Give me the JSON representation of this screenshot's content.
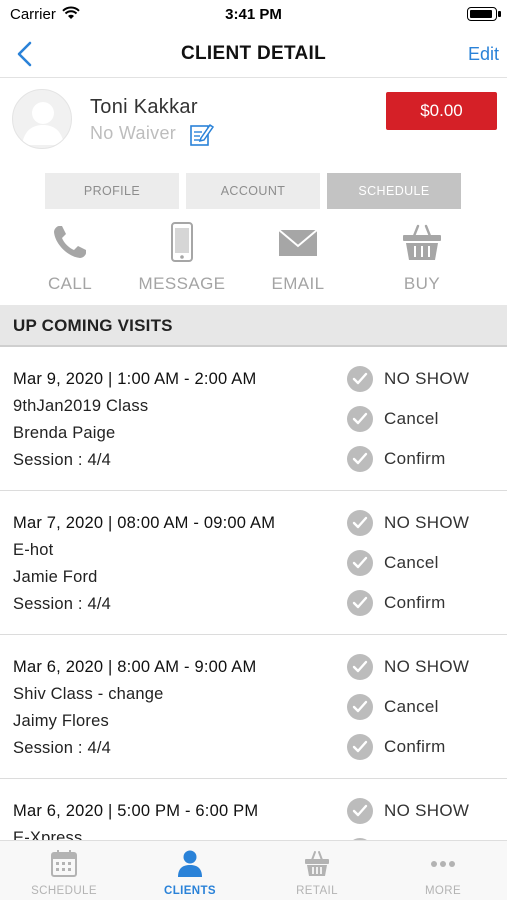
{
  "status_bar": {
    "carrier": "Carrier",
    "time": "3:41 PM"
  },
  "nav": {
    "title": "CLIENT DETAIL",
    "edit": "Edit"
  },
  "client": {
    "name": "Toni Kakkar",
    "waiver": "No Waiver",
    "balance": "$0.00"
  },
  "tabs": [
    {
      "label": "PROFILE",
      "active": false
    },
    {
      "label": "ACCOUNT",
      "active": false
    },
    {
      "label": "SCHEDULE",
      "active": true
    }
  ],
  "actions": [
    {
      "label": "CALL",
      "icon": "phone-icon"
    },
    {
      "label": "MESSAGE",
      "icon": "mobile-phone-icon"
    },
    {
      "label": "EMAIL",
      "icon": "envelope-icon"
    },
    {
      "label": "BUY",
      "icon": "basket-icon"
    }
  ],
  "section_title": "UP COMING VISITS",
  "status_labels": [
    "NO SHOW",
    "Cancel",
    "Confirm"
  ],
  "visits": [
    {
      "datetime": "Mar 9, 2020 | 1:00 AM - 2:00 AM",
      "class": "9thJan2019 Class",
      "staff": "Brenda Paige",
      "session": "Session : 4/4"
    },
    {
      "datetime": "Mar 7, 2020 | 08:00 AM - 09:00 AM",
      "class": "E-hot",
      "staff": "Jamie Ford",
      "session": "Session : 4/4"
    },
    {
      "datetime": "Mar 6, 2020 | 8:00 AM - 9:00 AM",
      "class": "Shiv Class - change",
      "staff": "Jaimy Flores",
      "session": "Session : 4/4"
    },
    {
      "datetime": "Mar 6, 2020 | 5:00 PM - 6:00 PM",
      "class": "E-Xpress",
      "staff": "",
      "session": ""
    }
  ],
  "tabbar": [
    {
      "label": "SCHEDULE",
      "icon": "calendar-icon",
      "active": false
    },
    {
      "label": "CLIENTS",
      "icon": "person-icon",
      "active": true
    },
    {
      "label": "RETAIL",
      "icon": "basket-icon",
      "active": false
    },
    {
      "label": "MORE",
      "icon": "ellipsis-icon",
      "active": false
    }
  ],
  "colors": {
    "accent": "#2a82d8",
    "balance_bg": "#d52027",
    "check_gray": "#bcbcbc",
    "tab_active": "#c3c3c3"
  }
}
